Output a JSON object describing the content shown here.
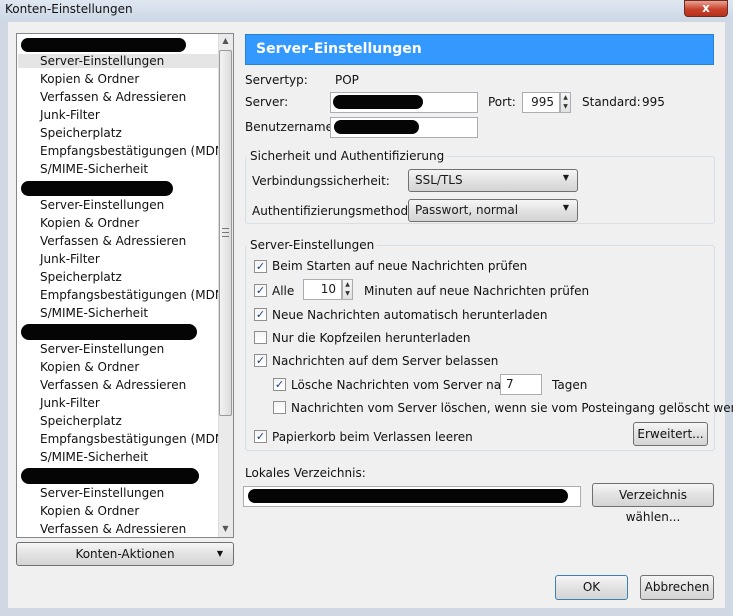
{
  "window": {
    "title": "Konten-Einstellungen",
    "close_label": "x"
  },
  "tree": {
    "groups": [
      {
        "items": [
          "Server-Einstellungen",
          "Kopien & Ordner",
          "Verfassen & Adressieren",
          "Junk-Filter",
          "Speicherplatz",
          "Empfangsbestätigungen (MDN)",
          "S/MIME-Sicherheit"
        ]
      },
      {
        "items": [
          "Server-Einstellungen",
          "Kopien & Ordner",
          "Verfassen & Adressieren",
          "Junk-Filter",
          "Speicherplatz",
          "Empfangsbestätigungen (MDN)",
          "S/MIME-Sicherheit"
        ]
      },
      {
        "items": [
          "Server-Einstellungen",
          "Kopien & Ordner",
          "Verfassen & Adressieren",
          "Junk-Filter",
          "Speicherplatz",
          "Empfangsbestätigungen (MDN)",
          "S/MIME-Sicherheit"
        ]
      },
      {
        "items": [
          "Server-Einstellungen",
          "Kopien & Ordner",
          "Verfassen & Adressieren"
        ]
      }
    ],
    "selected": "Server-Einstellungen"
  },
  "konten_aktionen": "Konten-Aktionen",
  "panel": {
    "header": "Server-Einstellungen",
    "servertyp_label": "Servertyp:",
    "servertyp_value": "POP",
    "server_label": "Server:",
    "port_label": "Port:",
    "port_value": "995",
    "standard_label": "Standard:",
    "standard_value": "995",
    "benutzername_label": "Benutzername:"
  },
  "security": {
    "title": "Sicherheit und Authentifizierung",
    "verbindung_label": "Verbindungssicherheit:",
    "verbindung_value": "SSL/TLS",
    "auth_label": "Authentifizierungsmethode:",
    "auth_value": "Passwort, normal"
  },
  "server_settings": {
    "title": "Server-Einstellungen",
    "check_start": {
      "label": "Beim Starten auf neue Nachrichten prüfen",
      "checked": true
    },
    "check_alle": {
      "label": "Alle",
      "checked": true,
      "minutes": "10",
      "suffix": "Minuten auf neue Nachrichten prüfen"
    },
    "auto_download": {
      "label": "Neue Nachrichten automatisch herunterladen",
      "checked": true
    },
    "headers_only": {
      "label": "Nur die Kopfzeilen herunterladen",
      "checked": false
    },
    "leave_on_server": {
      "label": "Nachrichten auf dem Server belassen",
      "checked": true
    },
    "delete_after": {
      "label": "Lösche Nachrichten vom Server nach",
      "checked": true,
      "days": "7",
      "suffix": "Tagen"
    },
    "delete_when_deleted": {
      "label": "Nachrichten vom Server löschen, wenn sie vom Posteingang gelöscht werden",
      "checked": false
    },
    "empty_trash": {
      "label": "Papierkorb beim Verlassen leeren",
      "checked": true
    },
    "erweitert_button": "Erweitert..."
  },
  "local": {
    "label": "Lokales Verzeichnis:",
    "button": "Verzeichnis wählen..."
  },
  "footer": {
    "ok": "OK",
    "cancel": "Abbrechen"
  },
  "colors": {
    "header_bg": "#3399ff",
    "window_bg": "#f0f0f0",
    "check": "#1d3f75"
  }
}
